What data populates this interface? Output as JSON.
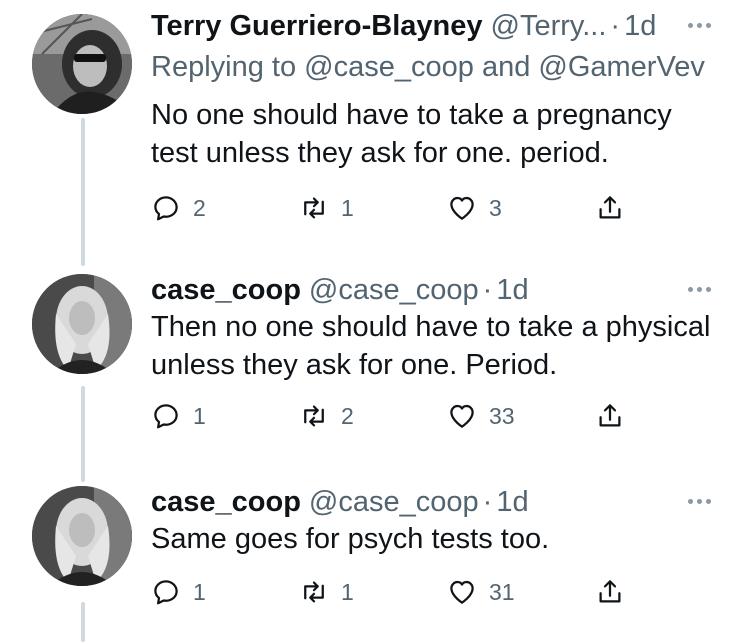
{
  "thread": [
    {
      "name": "Terry Guerriero-Blayney",
      "handle": "@Terry...",
      "dot": "·",
      "time": "1d",
      "replying_prefix": "Replying to",
      "replying_user1": "@case_coop",
      "replying_and": "and",
      "replying_user2": "@GamerVev",
      "text": "No one should have to take a pregnancy test unless they ask for one. period.",
      "stats": {
        "replies": "2",
        "retweets": "1",
        "likes": "3"
      }
    },
    {
      "name": "case_coop",
      "handle": "@case_coop",
      "dot": "·",
      "time": "1d",
      "text": "Then no one should have to take a physical unless they ask for one. Period.",
      "stats": {
        "replies": "1",
        "retweets": "2",
        "likes": "33"
      }
    },
    {
      "name": "case_coop",
      "handle": "@case_coop",
      "dot": "·",
      "time": "1d",
      "text": "Same goes for psych tests too.",
      "stats": {
        "replies": "1",
        "retweets": "1",
        "likes": "31"
      }
    }
  ],
  "icons": {
    "reply": "speech-bubble",
    "retweet": "retweet-arrows",
    "like": "heart",
    "share": "share-arrow-up",
    "more": "three-dots"
  },
  "colors": {
    "text_primary": "#0f1419",
    "text_secondary": "#536471",
    "thread_line": "#cfd9de"
  }
}
